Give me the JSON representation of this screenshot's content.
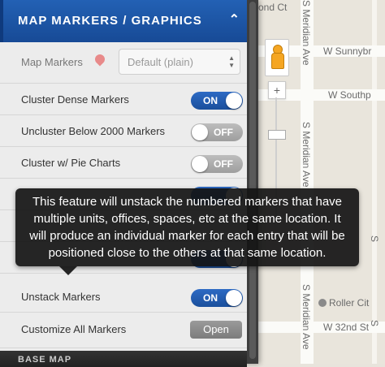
{
  "map": {
    "streets": {
      "top": "ond Ct",
      "meridian_top": "S Meridian Ave",
      "sunnybrook": "W Sunnybr",
      "southport": "W Southp",
      "meridian_mid": "S Meridian Ave",
      "meridian_bottom": "S Meridian Ave",
      "s_label": "S",
      "roller_city": "Roller Cit",
      "w32nd": "W 32nd St",
      "w32nd_s": "S"
    },
    "zoom_in_label": "+"
  },
  "panel": {
    "header_title": "MAP MARKERS / GRAPHICS",
    "header_icon": "chevron-up-icon",
    "map_markers_label": "Map Markers",
    "map_markers_select": "Default (plain)",
    "rows": [
      {
        "label": "Cluster Dense Markers",
        "state": "ON"
      },
      {
        "label": "Uncluster Below 2000 Markers",
        "state": "OFF"
      },
      {
        "label": "Cluster w/ Pie Charts",
        "state": "OFF"
      }
    ],
    "unstack_label": "Unstack Markers",
    "unstack_state": "ON",
    "customize_label": "Customize All Markers",
    "customize_button": "Open",
    "bottom_section": "BASE MAP"
  },
  "tooltip": {
    "text": "This feature will unstack the numbered markers that have multiple units, offices, spaces, etc at the same location.  It will produce an individual marker for each entry that will be positioned close to the others at that same location."
  },
  "colors": {
    "header_blue": "#1d56a8",
    "toggle_on": "#2160b8",
    "toggle_off": "#a8a8a8"
  }
}
